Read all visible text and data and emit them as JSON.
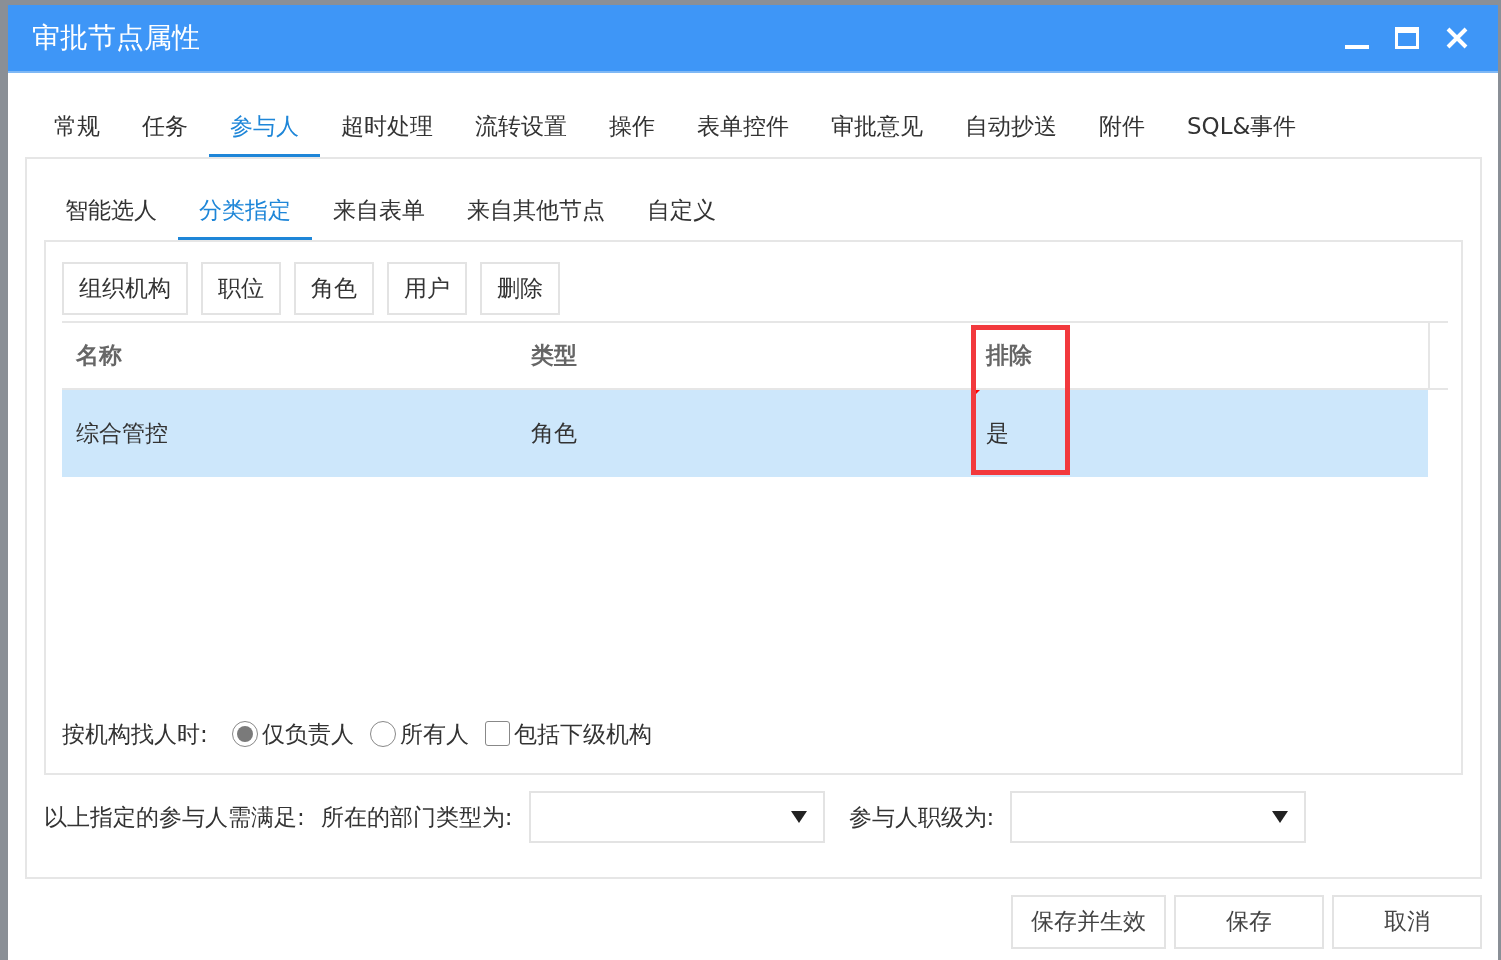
{
  "window": {
    "title": "审批节点属性"
  },
  "tabs": [
    {
      "label": "常规",
      "selected": false
    },
    {
      "label": "任务",
      "selected": false
    },
    {
      "label": "参与人",
      "selected": true
    },
    {
      "label": "超时处理",
      "selected": false
    },
    {
      "label": "流转设置",
      "selected": false
    },
    {
      "label": "操作",
      "selected": false
    },
    {
      "label": "表单控件",
      "selected": false
    },
    {
      "label": "审批意见",
      "selected": false
    },
    {
      "label": "自动抄送",
      "selected": false
    },
    {
      "label": "附件",
      "selected": false
    },
    {
      "label": "SQL&事件",
      "selected": false
    }
  ],
  "subtabs": [
    {
      "label": "智能选人",
      "selected": false
    },
    {
      "label": "分类指定",
      "selected": true
    },
    {
      "label": "来自表单",
      "selected": false
    },
    {
      "label": "来自其他节点",
      "selected": false
    },
    {
      "label": "自定义",
      "selected": false
    }
  ],
  "toolbar": [
    "组织机构",
    "职位",
    "角色",
    "用户",
    "删除"
  ],
  "table": {
    "columns": [
      {
        "label": "名称",
        "highlighted": false
      },
      {
        "label": "类型",
        "highlighted": false
      },
      {
        "label": "排除",
        "highlighted": true
      }
    ],
    "rows": [
      {
        "selected": true,
        "cells": [
          {
            "text": "综合管控",
            "edited": false
          },
          {
            "text": "角色",
            "edited": false
          },
          {
            "text": "是",
            "edited": true
          }
        ]
      }
    ]
  },
  "org_search": {
    "label": "按机构找人时:",
    "options": [
      {
        "kind": "radio",
        "label": "仅负责人",
        "checked": true
      },
      {
        "kind": "radio",
        "label": "所有人",
        "checked": false
      },
      {
        "kind": "checkbox",
        "label": "包括下级机构",
        "checked": false
      }
    ]
  },
  "conditions": {
    "label": "以上指定的参与人需满足:",
    "fields": [
      {
        "label": "所在的部门类型为:"
      },
      {
        "label": "参与人职级为:"
      }
    ]
  },
  "buttons": [
    "保存并生效",
    "保存",
    "取消"
  ]
}
